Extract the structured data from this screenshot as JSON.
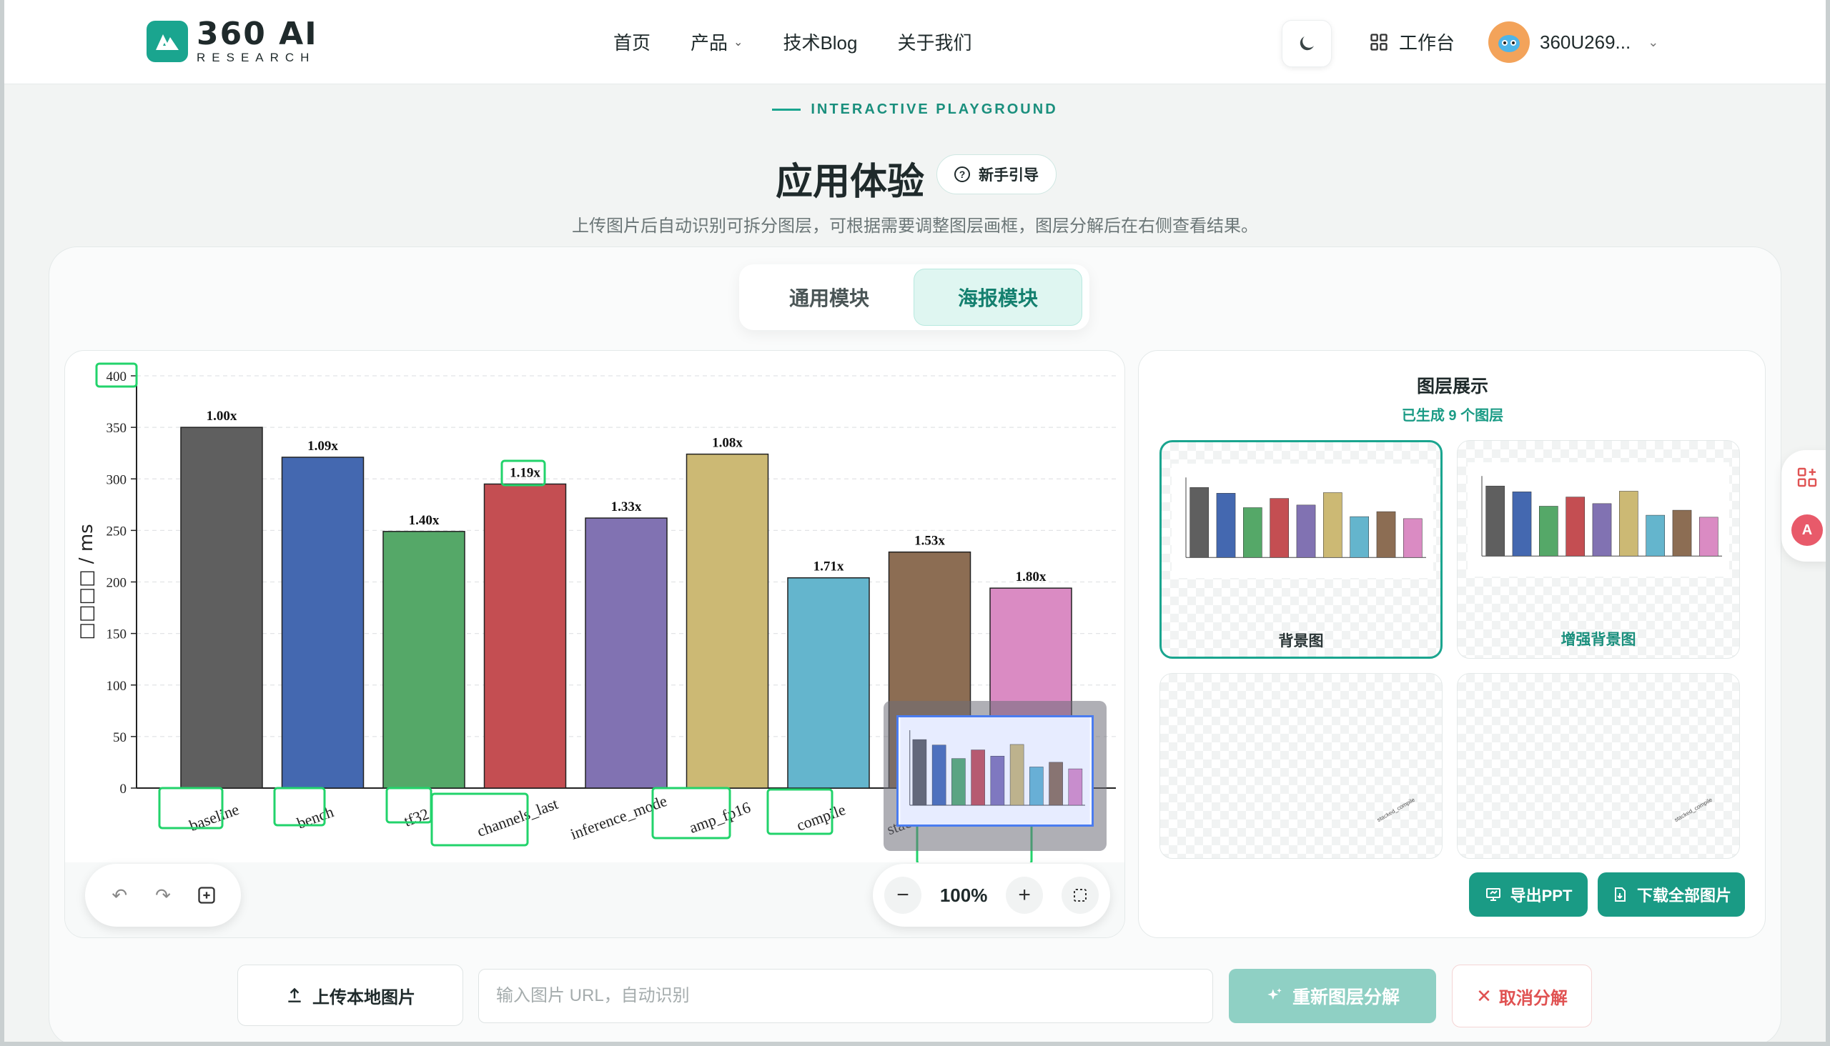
{
  "header": {
    "logo_main": "360 AI",
    "logo_sub": "RESEARCH",
    "nav": [
      {
        "label": "首页"
      },
      {
        "label": "产品"
      },
      {
        "label": "技术Blog"
      },
      {
        "label": "关于我们"
      }
    ],
    "workbench_label": "工作台",
    "username": "360U269..."
  },
  "hero": {
    "eyebrow": "INTERACTIVE PLAYGROUND",
    "title": "应用体验",
    "guide_label": "新手引导",
    "subtitle": "上传图片后自动识别可拆分图层，可根据需要调整图层画框，图层分解后在右侧查看结果。"
  },
  "tabs": [
    {
      "label": "通用模块",
      "active": false
    },
    {
      "label": "海报模块",
      "active": true
    }
  ],
  "canvas": {
    "zoom": "100%",
    "highlight_color": "#22d36b"
  },
  "chart_data": {
    "type": "bar",
    "ylabel": "□□□□ / ms",
    "ylim": [
      0,
      400
    ],
    "yticks": [
      0,
      50,
      100,
      150,
      200,
      250,
      300,
      350,
      400
    ],
    "categories": [
      "baseline",
      "bench",
      "tf32",
      "channels_last",
      "inference_mode",
      "amp_fp16",
      "compile",
      "stacked_c...",
      ""
    ],
    "values": [
      350,
      321,
      249,
      295,
      262,
      324,
      204,
      229,
      194
    ],
    "labels": [
      "1.00x",
      "1.09x",
      "1.40x",
      "1.19x",
      "1.33x",
      "1.08x",
      "1.71x",
      "1.53x",
      "1.80x"
    ],
    "colors": [
      "#5f5f5f",
      "#4468b0",
      "#55a868",
      "#c44e52",
      "#8172b2",
      "#ccb974",
      "#64b5cd",
      "#8c6d53",
      "#da8bc3"
    ],
    "grid": true
  },
  "layers": {
    "title": "图层展示",
    "count_text": "已生成 9 个图层",
    "cards": [
      {
        "caption": "背景图",
        "selected": true
      },
      {
        "caption": "增强背景图",
        "selected": false
      },
      {
        "caption": "",
        "selected": false
      },
      {
        "caption": "",
        "selected": false
      }
    ],
    "export_ppt": "导出PPT",
    "download_all": "下载全部图片"
  },
  "bottom": {
    "upload_label": "上传本地图片",
    "url_placeholder": "输入图片 URL，自动识别",
    "redecompose_label": "重新图层分解",
    "cancel_label": "取消分解"
  }
}
